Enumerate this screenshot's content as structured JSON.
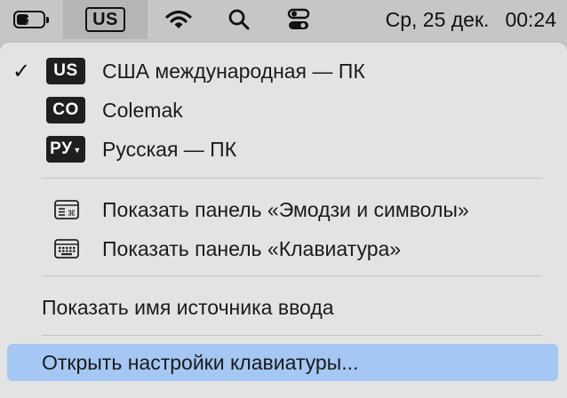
{
  "menubar": {
    "battery_level": 0.45,
    "input_source": "US",
    "day": "Ср, 25 дек.",
    "time": "00:24",
    "icons": [
      "battery-charging-icon",
      "wifi-icon",
      "search-icon",
      "control-center-icon"
    ]
  },
  "menu": {
    "layouts": [
      {
        "badge": "US",
        "label": "США международная — ПК",
        "checked": true
      },
      {
        "badge": "CO",
        "label": "Colemak",
        "checked": false
      },
      {
        "badge": "РУ",
        "label": "Русская — ПК",
        "checked": false
      }
    ],
    "show_emoji": "Показать панель «Эмодзи и символы»",
    "show_keyboard": "Показать панель «Клавиатура»",
    "show_source_name": "Показать имя источника ввода",
    "open_settings": "Открыть настройки клавиатуры..."
  },
  "colors": {
    "menubar_bg": "#c6c6c6",
    "menu_bg": "#e3e3e3",
    "highlight": "#a4c7f3"
  }
}
